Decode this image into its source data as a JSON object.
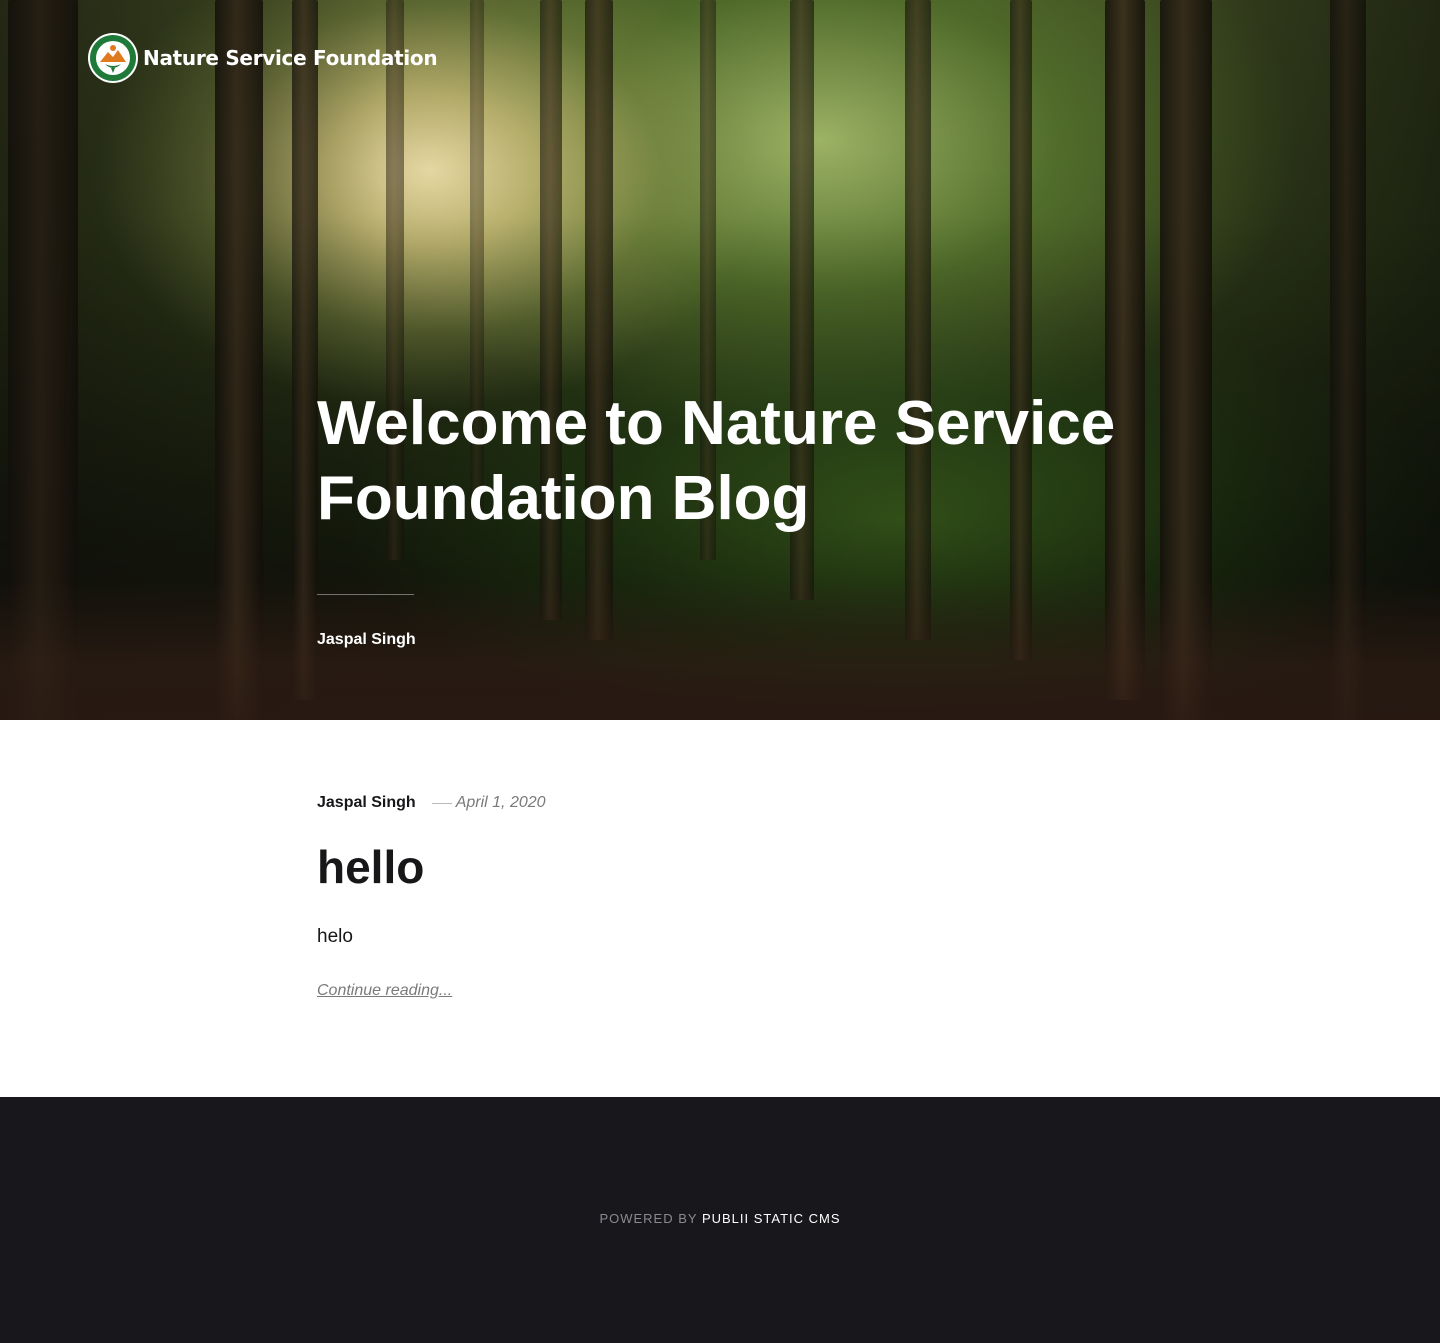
{
  "site": {
    "logo_text": "Nature Service Foundation",
    "logo_icon": "nature-service-foundation-emblem"
  },
  "hero": {
    "title": "Welcome to Nature Service Foundation Blog",
    "author": "Jaspal Singh"
  },
  "post": {
    "author": "Jaspal Singh",
    "date": "April 1, 2020",
    "title": "hello",
    "excerpt": "helo",
    "continue_label": "Continue reading..."
  },
  "footer": {
    "powered_by_label": "Powered by",
    "cms_link_label": "Publii Static CMS"
  },
  "colors": {
    "footer_bg": "#17171c",
    "text_dark": "#17171a",
    "muted": "#7a7a7a",
    "logo_green": "#1f7a3a",
    "logo_orange": "#e07a1f"
  }
}
